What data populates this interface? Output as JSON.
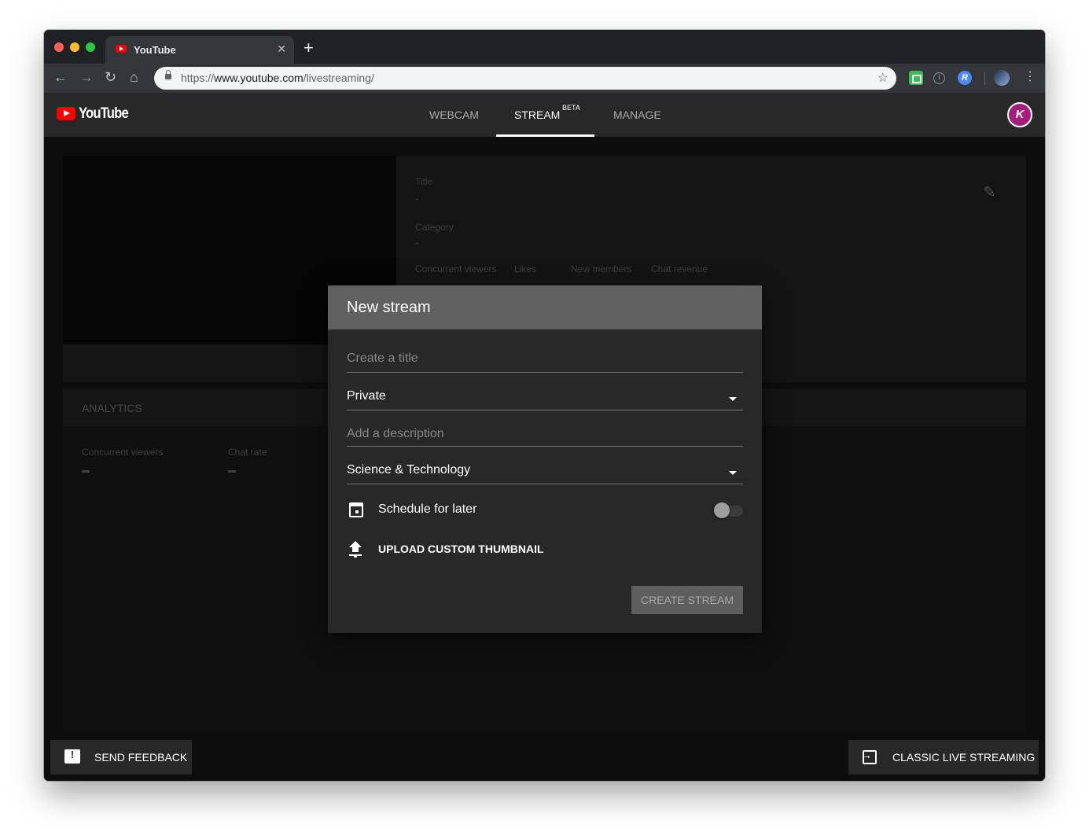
{
  "browser": {
    "tab_title": "YouTube",
    "tab_close": "✕",
    "new_tab": "+",
    "url_prefix": "https://",
    "url_host": "www.youtube.com",
    "url_path": "/livestreaming/",
    "nav": {
      "back": "←",
      "forward": "→",
      "reload": "↻",
      "home": "⌂"
    },
    "star": "☆",
    "menu": "⋮",
    "ext_info": "i",
    "ext_blue": "R"
  },
  "header": {
    "logo_text": "YouTube",
    "tabs": [
      {
        "label": "WEBCAM"
      },
      {
        "label": "STREAM"
      },
      {
        "label": "MANAGE"
      }
    ],
    "beta_badge": "BETA",
    "user_initial": "K"
  },
  "background": {
    "title_label": "Title",
    "title_value": "-",
    "category_label": "Category",
    "category_value": "-",
    "stats": [
      "Concurrent viewers",
      "Likes",
      "New members",
      "Chat revenue"
    ],
    "analytics_title": "ANALYTICS",
    "analytics_stats": [
      "Concurrent viewers",
      "Chat rate"
    ]
  },
  "modal": {
    "title": "New stream",
    "title_placeholder": "Create a title",
    "privacy_value": "Private",
    "description_placeholder": "Add a description",
    "category_value": "Science & Technology",
    "schedule_label": "Schedule for later",
    "schedule_enabled": false,
    "upload_label": "UPLOAD CUSTOM THUMBNAIL",
    "create_button": "CREATE STREAM"
  },
  "footer": {
    "feedback_label": "SEND FEEDBACK",
    "classic_label": "CLASSIC LIVE STREAMING"
  },
  "icons": [
    "calendar-icon",
    "upload-icon",
    "feedback-icon",
    "exit-icon",
    "edit-icon",
    "lock-icon",
    "star-icon"
  ],
  "colors": {
    "accent": "#ff0000",
    "modal_header": "#606060",
    "modal_body": "#282828",
    "avatar": "#a61d7d"
  }
}
